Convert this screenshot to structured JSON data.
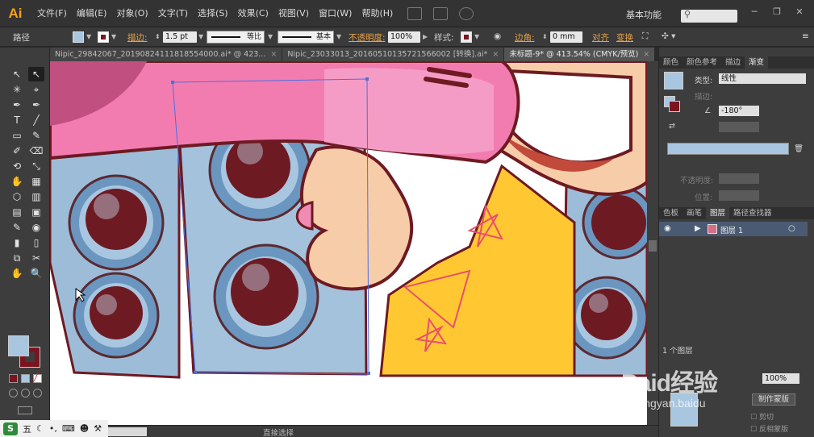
{
  "app": {
    "logo": "Ai",
    "menus": [
      "文件(F)",
      "编辑(E)",
      "对象(O)",
      "文字(T)",
      "选择(S)",
      "效果(C)",
      "视图(V)",
      "窗口(W)",
      "帮助(H)"
    ],
    "workspace": "基本功能",
    "window_buttons": [
      "─",
      "❐",
      "✕"
    ]
  },
  "control": {
    "path_label": "路径",
    "stroke_label": "描边:",
    "stroke_value": "1.5 pt",
    "profile_label": "等比",
    "brush_label": "基本",
    "opacity_label": "不透明度:",
    "opacity_value": "100%",
    "style_label": "样式:",
    "corner_label": "边角:",
    "corner_value": "0 mm",
    "align_label": "对齐",
    "transform_label": "变换"
  },
  "tabs": [
    {
      "label": "Nipic_29842067_20190824111818554000.ai* @ 423...",
      "active": false
    },
    {
      "label": "Nipic_23033013_20160510135721566002 [转换].ai*",
      "active": false
    },
    {
      "label": "未标题-9* @ 413.54% (CMYK/预览)",
      "active": true
    }
  ],
  "tools": [
    "↖",
    "↖",
    "✳",
    "⌖",
    "✒",
    "✒",
    "T",
    "╱",
    "▭",
    "✎",
    "✐",
    "⌫",
    "⟲",
    "⤡",
    "✋",
    "▦",
    "⬡",
    "▥",
    "▤",
    "▣",
    "✎",
    "◉",
    "▮",
    "▯",
    "⧉",
    "✂",
    "✋",
    "🔍"
  ],
  "colors": {
    "fill": "#a8c6e0",
    "stroke": "#7a1520",
    "accent_orange": "#e8a247"
  },
  "status": {
    "tool_name": "直接选择"
  },
  "right_panel": {
    "top_tabs": [
      "颜色",
      "颜色参考",
      "描边",
      "渐变"
    ],
    "type_label": "类型:",
    "type_value": "线性",
    "stroke_label": "描边:",
    "angle_value": "-180°",
    "opacity_label": "不透明度:",
    "position_label": "位置:",
    "mid_tabs": [
      "色板",
      "画笔",
      "图层",
      "路径查找器"
    ],
    "layer_name": "图层 1",
    "layer_count": "1 个图层",
    "mask_opacity": "100%",
    "make_mask_button": "制作蒙版",
    "clip_label": "剪切",
    "invert_label": "反相蒙版"
  },
  "watermark": {
    "line1": "Baid经验",
    "line2": "jingyan.baidu"
  },
  "ime": {
    "icon": "S",
    "label": "五"
  }
}
